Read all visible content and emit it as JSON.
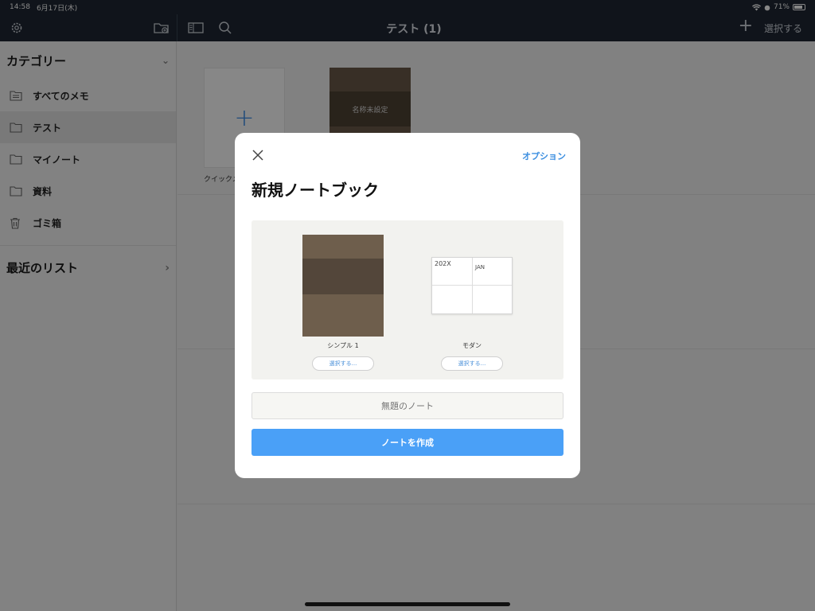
{
  "status_bar": {
    "time": "14:58",
    "date": "6月17日(木)",
    "battery": "71%"
  },
  "top_bar": {
    "title": "テスト (1)",
    "select_label": "選択する"
  },
  "sidebar": {
    "category_header": "カテゴリー",
    "items": [
      {
        "label": "すべてのメモ",
        "icon": "note-list-icon"
      },
      {
        "label": "テスト",
        "icon": "folder-icon",
        "active": true
      },
      {
        "label": "マイノート",
        "icon": "folder-icon"
      },
      {
        "label": "資料",
        "icon": "folder-icon"
      },
      {
        "label": "ゴミ箱",
        "icon": "trash-icon"
      }
    ],
    "recent_header": "最近のリスト"
  },
  "main": {
    "quick_card_label": "クイックメ",
    "notebook_title": "名称未設定"
  },
  "modal": {
    "options_label": "オプション",
    "heading": "新規ノートブック",
    "templates": [
      {
        "name": "シンプル 1",
        "button": "選択する..."
      },
      {
        "name": "モダン",
        "button": "選択する...",
        "year": "202X",
        "month": "JAN"
      }
    ],
    "title_placeholder": "無題のノート",
    "create_button": "ノートを作成"
  },
  "colors": {
    "accent": "#4aa0f7",
    "topbar": "#1f2733",
    "cover": "#6e5e4c"
  }
}
